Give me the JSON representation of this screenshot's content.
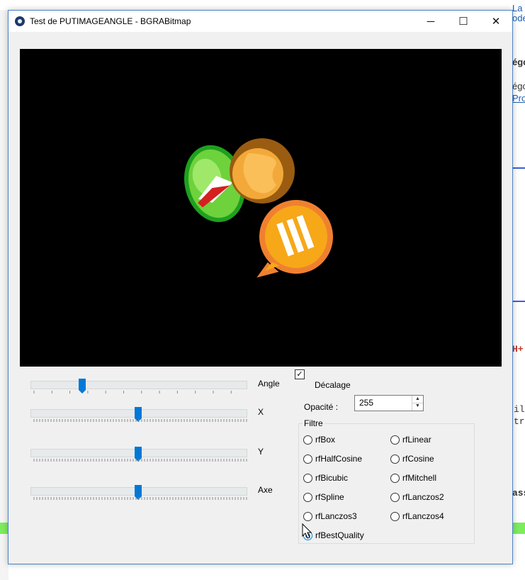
{
  "background": {
    "right_text_1": "La balis",
    "right_text_2": "ode",
    "right_text_3": "égo",
    "right_text_4": "égo",
    "right_text_5": "Prog",
    "right_text_6": "H+",
    "right_text_7": "ila",
    "right_text_8": "tr",
    "right_text_9": "ass"
  },
  "window": {
    "title": "Test de PUTIMAGEANGLE - BGRABitmap",
    "minimize_glyph": "─",
    "maximize_glyph": "☐",
    "close_glyph": "✕"
  },
  "sliders": [
    {
      "label": "Angle",
      "value_fraction": 0.24
    },
    {
      "label": "X",
      "value_fraction": 0.5
    },
    {
      "label": "Y",
      "value_fraction": 0.5
    },
    {
      "label": "Axe",
      "value_fraction": 0.5
    }
  ],
  "offset_checkbox": {
    "label": "Décalage",
    "checked": true,
    "check_glyph": "✓"
  },
  "opacity": {
    "label": "Opacité :",
    "value": "255",
    "up_glyph": "▲",
    "down_glyph": "▼"
  },
  "filter": {
    "title": "Filtre",
    "options": [
      "rfBox",
      "rfLinear",
      "rfHalfCosine",
      "rfCosine",
      "rfBicubic",
      "rfMitchell",
      "rfSpline",
      "rfLanczos2",
      "rfLanczos3",
      "rfLanczos4",
      "rfBestQuality"
    ],
    "selected": "rfBestQuality"
  },
  "colors": {
    "accent": "#0078d7",
    "canvas": "#000000",
    "window_border": "#4b84c6"
  }
}
